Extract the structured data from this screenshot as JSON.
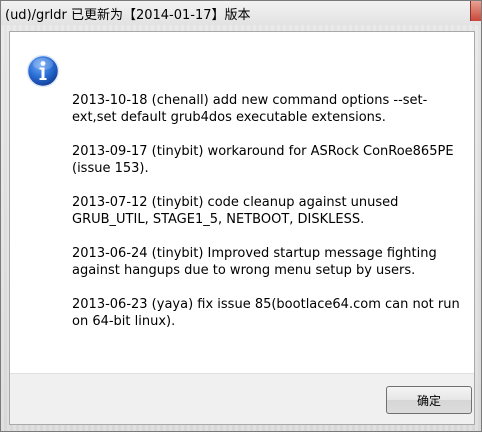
{
  "window": {
    "title": "(ud)/grldr 已更新为【2014-01-17】版本"
  },
  "dialog": {
    "icon": "info-icon",
    "accent_color": "#1a5fc8",
    "messages": [
      "2013-10-18 (chenall) add new command options --set-ext,set default grub4dos executable extensions.",
      "2013-09-17 (tinybit) workaround for ASRock ConRoe865PE (issue 153).",
      "2013-07-12 (tinybit) code cleanup against unused GRUB_UTIL, STAGE1_5, NETBOOT, DISKLESS.",
      "2013-06-24 (tinybit) Improved startup message fighting against hangups due to wrong menu setup by users.",
      "2013-06-23 (yaya) fix issue 85(bootlace64.com can not run on 64-bit linux)."
    ],
    "ok_label": "确定"
  }
}
